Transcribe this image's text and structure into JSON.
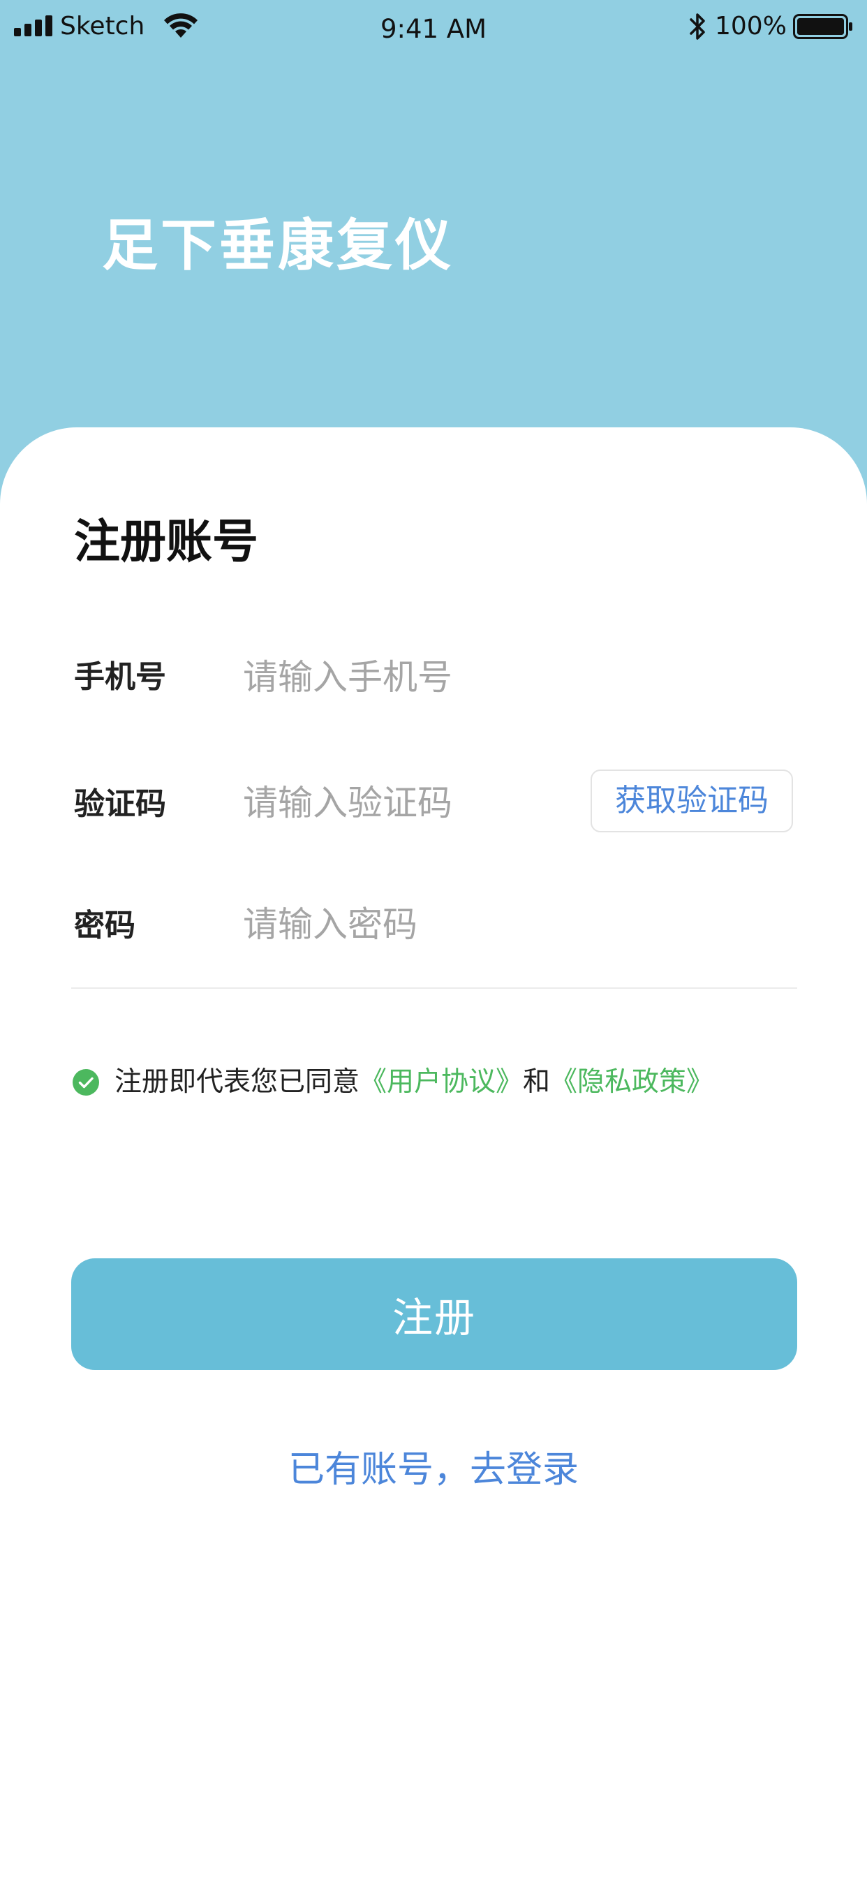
{
  "status_bar": {
    "carrier": "Sketch",
    "time": "9:41 AM",
    "battery_percent": "100%",
    "icons": [
      "signal-icon",
      "wifi-icon",
      "bluetooth-icon",
      "battery-icon"
    ]
  },
  "header": {
    "app_title": "足下垂康复仪"
  },
  "form": {
    "title": "注册账号",
    "phone": {
      "label": "手机号",
      "placeholder": "请输入手机号",
      "value": ""
    },
    "code": {
      "label": "验证码",
      "placeholder": "请输入验证码",
      "value": "",
      "get_code_label": "获取验证码"
    },
    "password": {
      "label": "密码",
      "placeholder": "请输入密码",
      "value": ""
    }
  },
  "agreement": {
    "checked": true,
    "prefix": "注册即代表您已同意",
    "user_agreement": "《用户协议》",
    "conjunction": "和",
    "privacy_policy": "《隐私政策》"
  },
  "actions": {
    "register_label": "注册",
    "login_link": "已有账号，去登录"
  },
  "colors": {
    "header_bg": "#91cfe2",
    "primary_button": "#67bed8",
    "link_blue": "#4c86da",
    "agreement_green": "#4cb85e",
    "check_green": "#4cb85e"
  }
}
